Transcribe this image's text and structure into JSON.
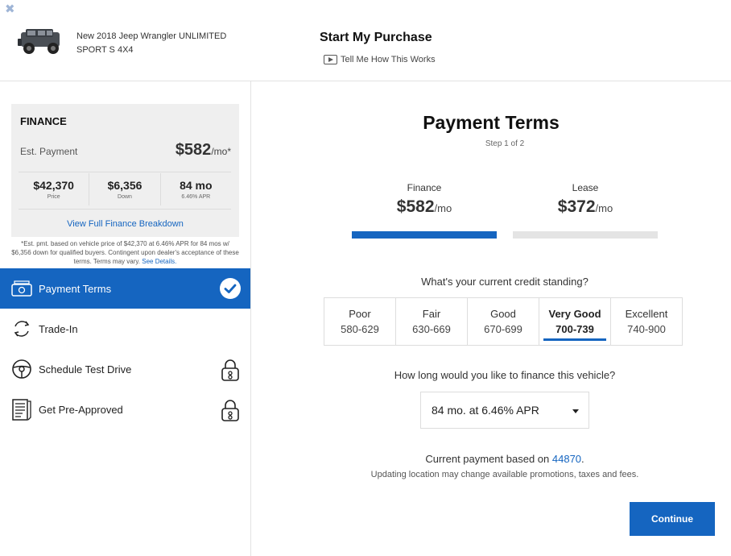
{
  "header": {
    "close_icon": "close-icon",
    "vehicle_name": "New 2018 Jeep Wrangler UNLIMITED SPORT S 4X4",
    "title": "Start My Purchase",
    "how_link": "Tell Me How This Works"
  },
  "finance_card": {
    "title": "FINANCE",
    "est_label": "Est. Payment",
    "est_value": "$582",
    "est_unit": "/mo*",
    "stats": [
      {
        "value": "$42,370",
        "label": "Price"
      },
      {
        "value": "$6,356",
        "label": "Down"
      },
      {
        "value": "84 mo",
        "label": "6.46% APR"
      }
    ],
    "breakdown_link": "View Full Finance Breakdown",
    "disclaimer": "*Est. pmt. based on vehicle price of $42,370 at 6.46% APR for 84 mos w/ $6,356 down for qualified buyers. Contingent upon dealer's acceptance of these terms. Terms may vary.",
    "see_details": "See Details."
  },
  "steps": [
    {
      "label": "Payment Terms",
      "icon": "money-icon",
      "status_icon": "check-circle-icon",
      "active": true
    },
    {
      "label": "Trade-In",
      "icon": "swap-arrows-icon",
      "active": false
    },
    {
      "label": "Schedule Test Drive",
      "icon": "steering-wheel-icon",
      "status_icon": "lock-icon",
      "active": false
    },
    {
      "label": "Get Pre-Approved",
      "icon": "document-icon",
      "status_icon": "lock-icon",
      "active": false
    }
  ],
  "payment_terms": {
    "title": "Payment Terms",
    "step": "Step 1 of 2",
    "tabs": [
      {
        "label": "Finance",
        "value": "$582",
        "unit": "/mo",
        "selected": true
      },
      {
        "label": "Lease",
        "value": "$372",
        "unit": "/mo",
        "selected": false
      }
    ],
    "credit_question": "What's your current credit standing?",
    "credit_options": [
      {
        "label": "Poor",
        "range": "580-629"
      },
      {
        "label": "Fair",
        "range": "630-669"
      },
      {
        "label": "Good",
        "range": "670-699"
      },
      {
        "label": "Very Good",
        "range": "700-739",
        "selected": true
      },
      {
        "label": "Excellent",
        "range": "740-900"
      }
    ],
    "term_question": "How long would you like to finance this vehicle?",
    "term_selected": "84 mo. at 6.46% APR",
    "current_payment_prefix": "Current payment based on",
    "zip": "44870",
    "update_note": "Updating location may change available promotions, taxes and fees.",
    "continue_label": "Continue"
  },
  "colors": {
    "accent": "#1565c0",
    "card_bg": "#efefef"
  }
}
